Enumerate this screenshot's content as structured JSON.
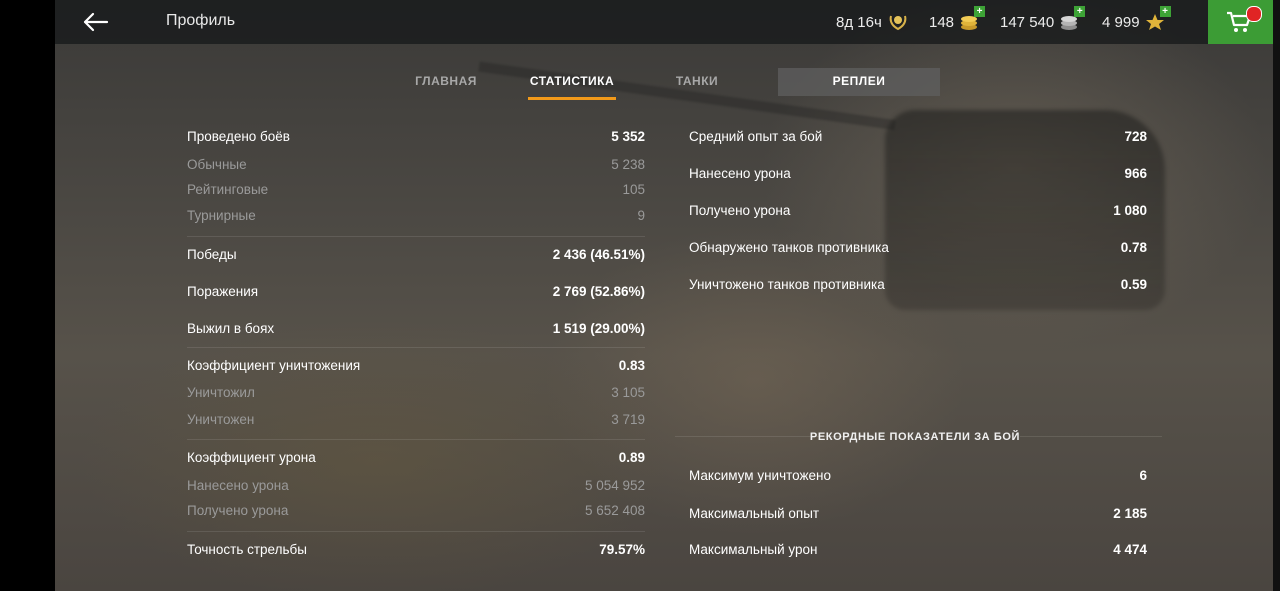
{
  "header": {
    "title": "Профиль",
    "premium_time": "8д 16ч",
    "gold": "148",
    "credits": "147 540",
    "free_xp": "4 999"
  },
  "tabs": [
    {
      "label": "ГЛАВНАЯ"
    },
    {
      "label": "СТАТИСТИКА"
    },
    {
      "label": "ТАНКИ"
    },
    {
      "label": "РЕПЛЕИ"
    }
  ],
  "left_stats": [
    {
      "label": "Проведено боёв",
      "value": "5 352",
      "kind": "main"
    },
    {
      "label": "Обычные",
      "value": "5 238",
      "kind": "sub"
    },
    {
      "label": "Рейтинговые",
      "value": "105",
      "kind": "sub"
    },
    {
      "label": "Турнирные",
      "value": "9",
      "kind": "sub"
    },
    {
      "label": "Победы",
      "value": "2 436 (46.51%)",
      "kind": "main"
    },
    {
      "label": "Поражения",
      "value": "2 769 (52.86%)",
      "kind": "main"
    },
    {
      "label": "Выжил в боях",
      "value": "1 519 (29.00%)",
      "kind": "main"
    },
    {
      "label": "Коэффициент уничтожения",
      "value": "0.83",
      "kind": "main"
    },
    {
      "label": "Уничтожил",
      "value": "3 105",
      "kind": "sub"
    },
    {
      "label": "Уничтожен",
      "value": "3 719",
      "kind": "sub"
    },
    {
      "label": "Коэффициент урона",
      "value": "0.89",
      "kind": "main"
    },
    {
      "label": "Нанесено урона",
      "value": "5 054 952",
      "kind": "sub"
    },
    {
      "label": "Получено урона",
      "value": "5 652 408",
      "kind": "sub"
    },
    {
      "label": "Точность стрельбы",
      "value": "79.57%",
      "kind": "main"
    }
  ],
  "right_stats": [
    {
      "label": "Средний опыт за бой",
      "value": "728"
    },
    {
      "label": "Нанесено урона",
      "value": "966"
    },
    {
      "label": "Получено урона",
      "value": "1 080"
    },
    {
      "label": "Обнаружено танков противника",
      "value": "0.78"
    },
    {
      "label": "Уничтожено танков противника",
      "value": "0.59"
    }
  ],
  "records": {
    "title": "РЕКОРДНЫЕ ПОКАЗАТЕЛИ ЗА БОЙ",
    "items": [
      {
        "label": "Максимум уничтожено",
        "value": "6"
      },
      {
        "label": "Максимальный опыт",
        "value": "2 185"
      },
      {
        "label": "Максимальный урон",
        "value": "4 474"
      }
    ]
  },
  "colors": {
    "accent": "#f29a1a",
    "shop_green": "#3c9c35",
    "muted_text": "#9a9a9a"
  }
}
